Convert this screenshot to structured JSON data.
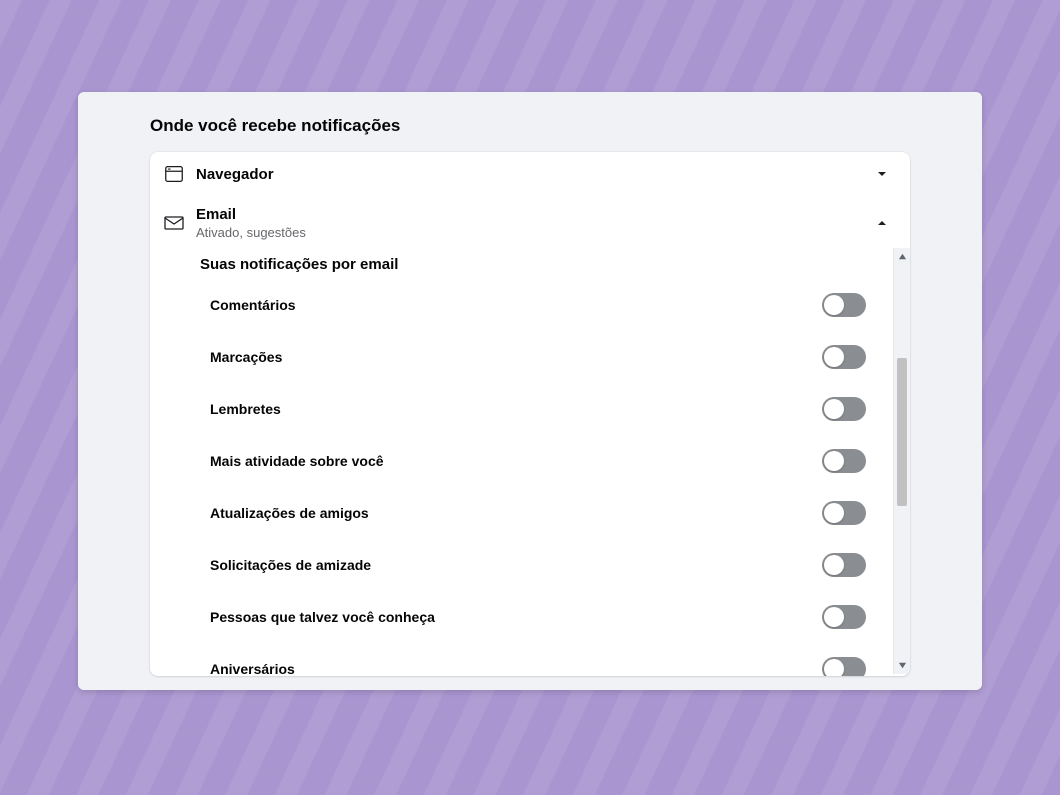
{
  "page_title": "Onde você recebe notificações",
  "browser_section": {
    "title": "Navegador"
  },
  "email_section": {
    "title": "Email",
    "subtitle": "Ativado, sugestões"
  },
  "email_sub_title": "Suas notificações por email",
  "toggles": {
    "comentarios": "Comentários",
    "marcacoes": "Marcações",
    "lembretes": "Lembretes",
    "mais_atividade": "Mais atividade sobre você",
    "atualizacoes": "Atualizações de amigos",
    "solicitacoes": "Solicitações de amizade",
    "pessoas": "Pessoas que talvez você conheça",
    "aniversarios": "Aniversários"
  }
}
